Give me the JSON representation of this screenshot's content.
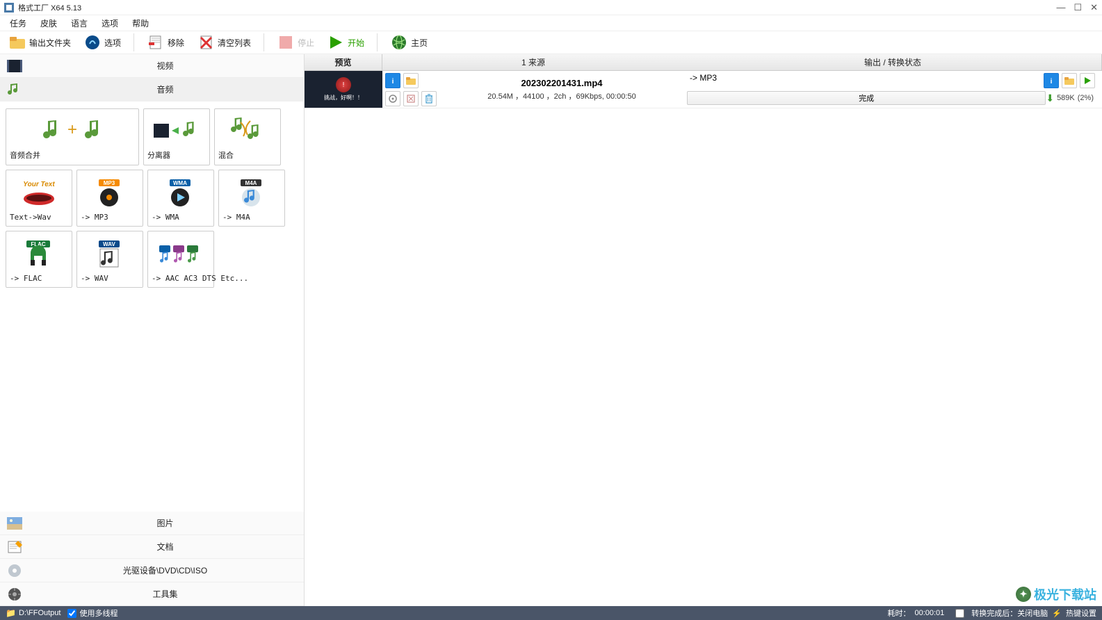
{
  "window": {
    "title": "格式工厂 X64 5.13"
  },
  "menu": {
    "task": "任务",
    "skin": "皮肤",
    "language": "语言",
    "option": "选项",
    "help": "帮助"
  },
  "toolbar": {
    "output_folder": "输出文件夹",
    "options": "选项",
    "remove": "移除",
    "clear": "清空列表",
    "stop": "停止",
    "start": "开始",
    "home": "主页"
  },
  "categories": {
    "video": "视频",
    "audio": "音频",
    "image": "图片",
    "document": "文档",
    "disc": "光驱设备\\DVD\\CD\\ISO",
    "toolset": "工具集"
  },
  "tiles": {
    "audio_merge": "音频合并",
    "splitter": "分离器",
    "mix": "混合",
    "text_wav": "Text->Wav",
    "mp3": "-> MP3",
    "wma": "-> WMA",
    "m4a": "-> M4A",
    "flac": "-> FLAC",
    "wav": "-> WAV",
    "aac_etc": "-> AAC AC3 DTS Etc..."
  },
  "task_header": {
    "preview": "预览",
    "source": "1 来源",
    "output": "输出 / 转换状态"
  },
  "task": {
    "thumb_text": "挑战，好啊！！",
    "filename": "202302201431.mp4",
    "meta": "20.54M ，44100 ，2ch ，69Kbps, 00:00:50",
    "output_fmt": "-> MP3",
    "status_label": "完成",
    "size": "589K",
    "percent": "(2%)"
  },
  "statusbar": {
    "output_path": "D:\\FFOutput",
    "multithread": "使用多线程",
    "elapsed_label": "耗时：",
    "elapsed_time": "00:00:01",
    "after_done": "转换完成后：关闭电脑",
    "hotkey": "热键设置"
  },
  "watermark": {
    "text": "极光下载站"
  }
}
